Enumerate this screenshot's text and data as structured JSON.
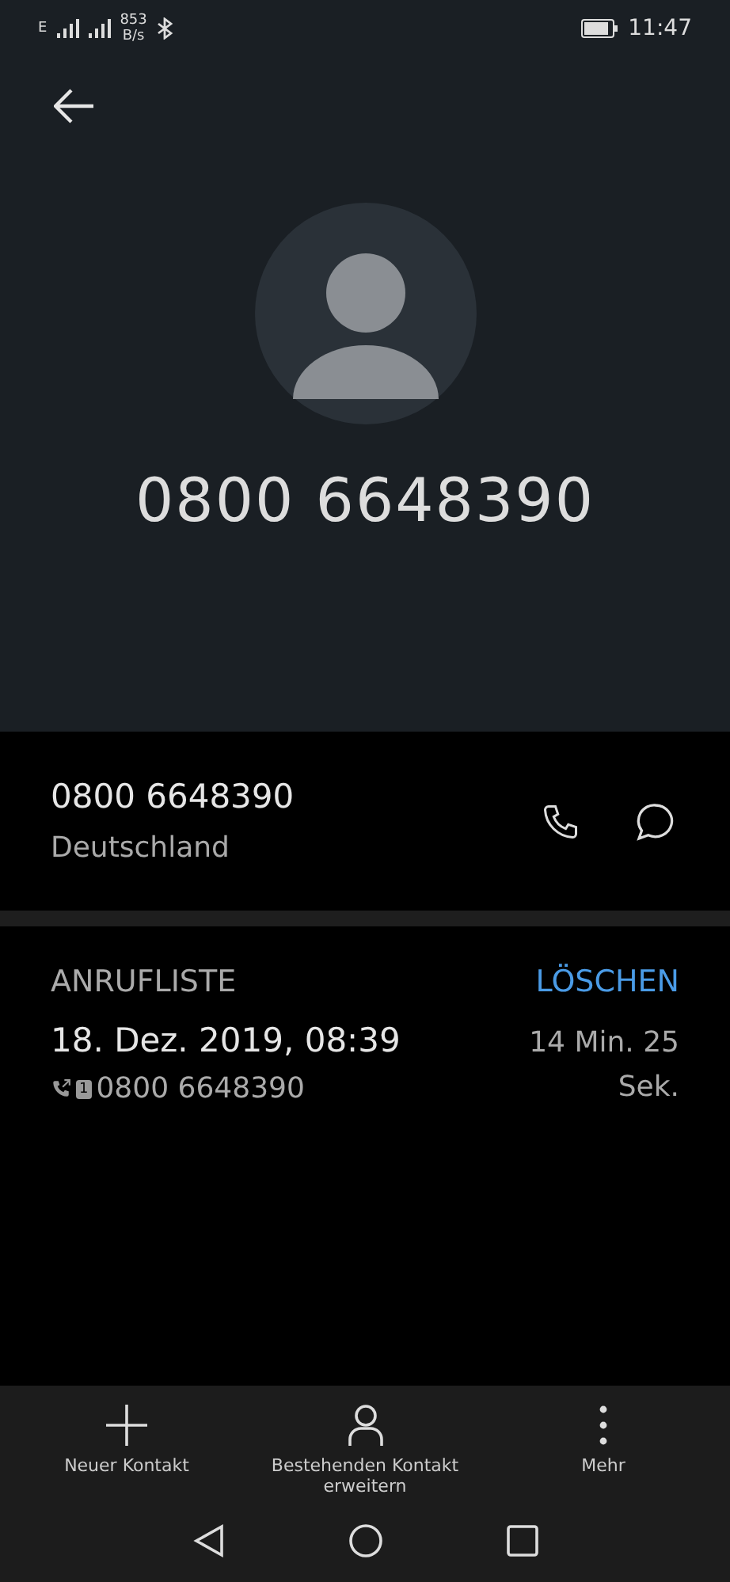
{
  "status_bar": {
    "network": "E",
    "speed_value": "853",
    "speed_unit": "B/s",
    "time": "11:47"
  },
  "header": {
    "number": "0800 6648390"
  },
  "contact": {
    "number": "0800 6648390",
    "country": "Deutschland"
  },
  "call_log": {
    "title": "ANRUFLISTE",
    "clear_label": "LÖSCHEN",
    "entries": [
      {
        "datetime": "18. Dez. 2019, 08:39",
        "sim": "1",
        "number": "0800 6648390",
        "duration": "14 Min. 25 Sek."
      }
    ]
  },
  "actions": [
    {
      "kind": "add",
      "label": "Neuer Kontakt"
    },
    {
      "kind": "person",
      "label": "Bestehenden Kontakt erweitern"
    },
    {
      "kind": "more",
      "label": "Mehr"
    }
  ]
}
